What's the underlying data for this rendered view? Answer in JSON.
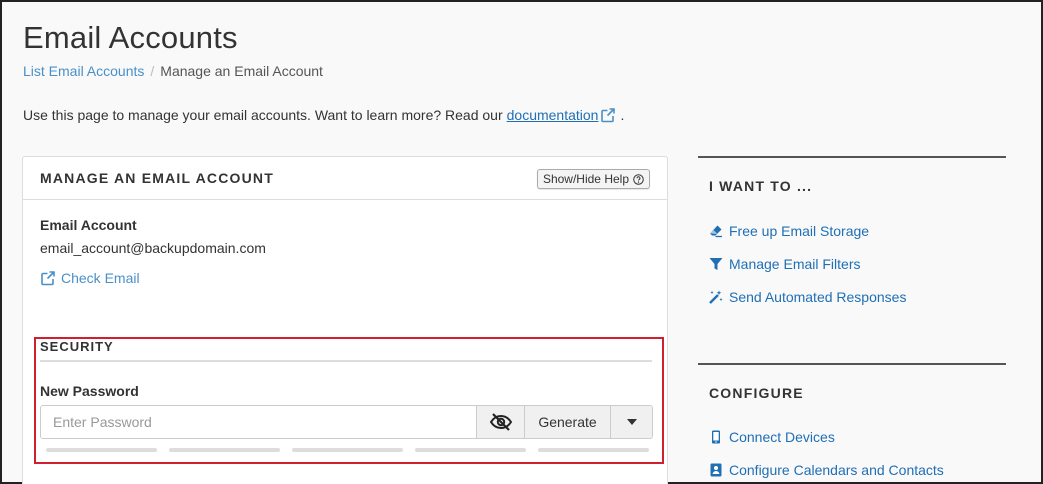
{
  "header": {
    "title": "Email Accounts",
    "breadcrumb": {
      "link": "List Email Accounts",
      "separator": "/",
      "current": "Manage an Email Account"
    }
  },
  "intro": {
    "text": "Use this page to manage your email accounts. Want to learn more? Read our",
    "link": "documentation",
    "trailing": "."
  },
  "panel": {
    "title": "MANAGE AN EMAIL ACCOUNT",
    "help_button": "Show/Hide Help",
    "account_label": "Email Account",
    "account_value": "email_account@backupdomain.com",
    "check_email": "Check Email",
    "security": {
      "title": "SECURITY",
      "password_label": "New Password",
      "password_placeholder": "Enter Password",
      "password_value": "",
      "generate_label": "Generate",
      "strength_segments": 5
    }
  },
  "sidebar": {
    "i_want_to": {
      "title": "I WANT TO ...",
      "items": [
        {
          "label": "Free up Email Storage",
          "icon": "eraser-icon"
        },
        {
          "label": "Manage Email Filters",
          "icon": "filter-icon"
        },
        {
          "label": "Send Automated Responses",
          "icon": "magic-wand-icon"
        }
      ]
    },
    "configure": {
      "title": "CONFIGURE",
      "items": [
        {
          "label": "Connect Devices",
          "icon": "mobile-icon"
        },
        {
          "label": "Configure Calendars and Contacts",
          "icon": "address-card-icon"
        }
      ]
    }
  },
  "colors": {
    "link": "#1f6fb5",
    "highlight": "#d0202f",
    "border": "#dddddd"
  }
}
